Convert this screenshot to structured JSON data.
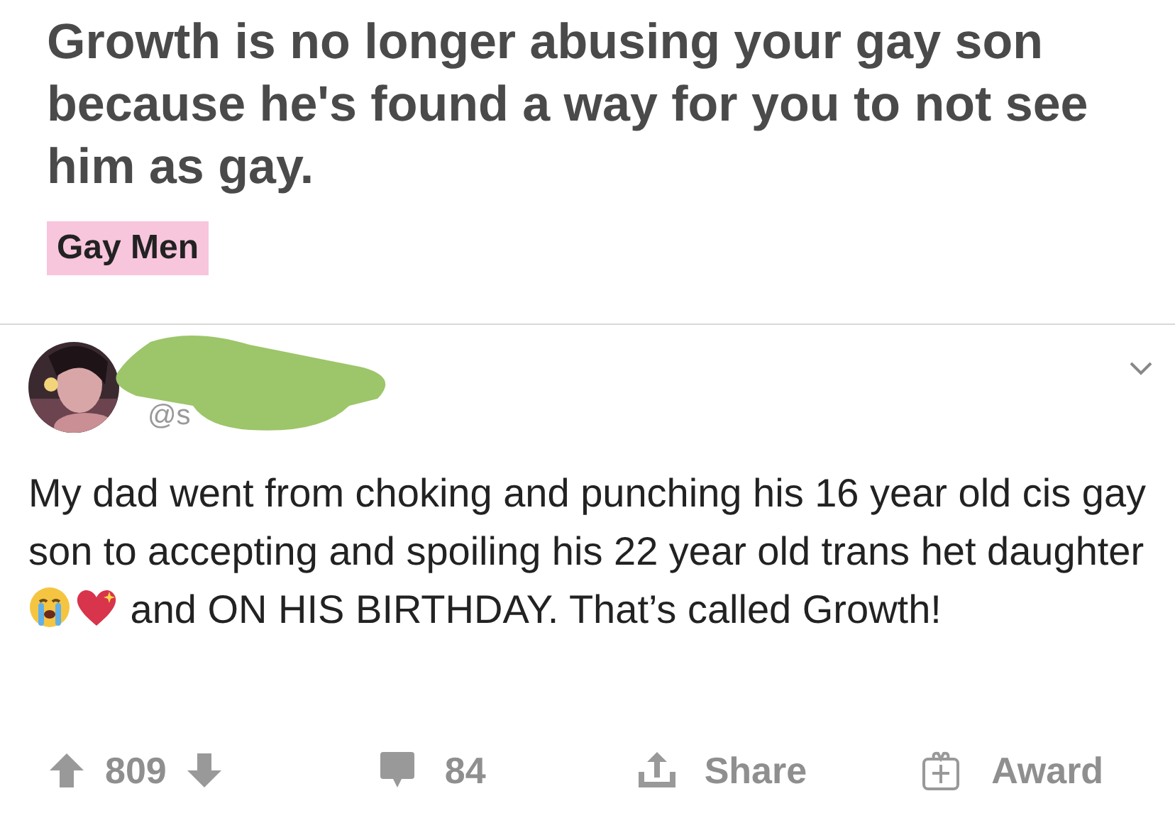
{
  "post": {
    "title": "Growth is no longer abusing your gay son because he's found a way for you to not see him as gay.",
    "flair": "Gay Men"
  },
  "tweet": {
    "handle": "@s",
    "text_before": "My dad went from choking and punching his 16 year old cis gay son to accepting and spoiling his 22 year old trans het daughter",
    "text_after": "and ON HIS BIRTHDAY. That’s called Growth!"
  },
  "actions": {
    "score": "809",
    "comments": "84",
    "share": "Share",
    "award": "Award"
  }
}
